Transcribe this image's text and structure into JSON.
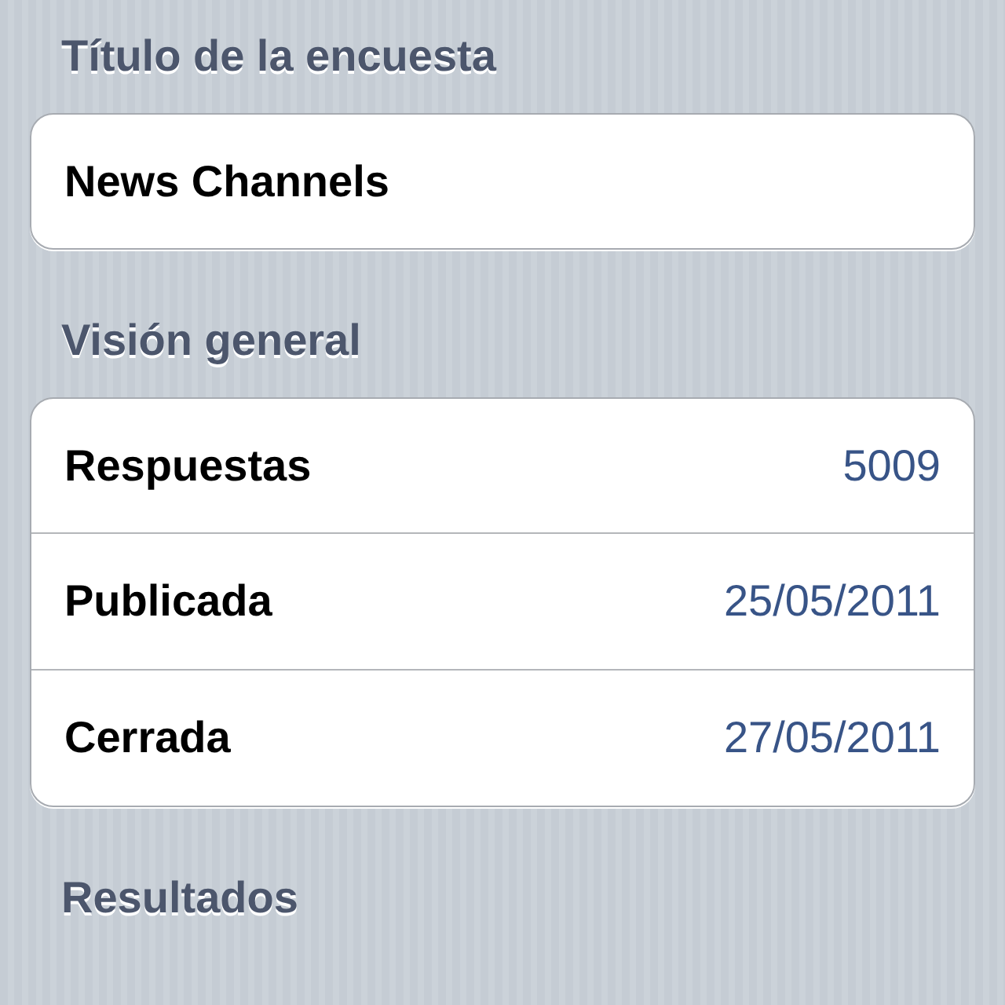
{
  "sections": [
    {
      "header": "Título de la encuesta",
      "rows": [
        {
          "label": "News Channels"
        }
      ]
    },
    {
      "header": "Visión general",
      "rows": [
        {
          "label": "Respuestas",
          "value": "5009"
        },
        {
          "label": "Publicada",
          "value": "25/05/2011"
        },
        {
          "label": "Cerrada",
          "value": "27/05/2011"
        }
      ]
    },
    {
      "header": "Resultados"
    }
  ]
}
